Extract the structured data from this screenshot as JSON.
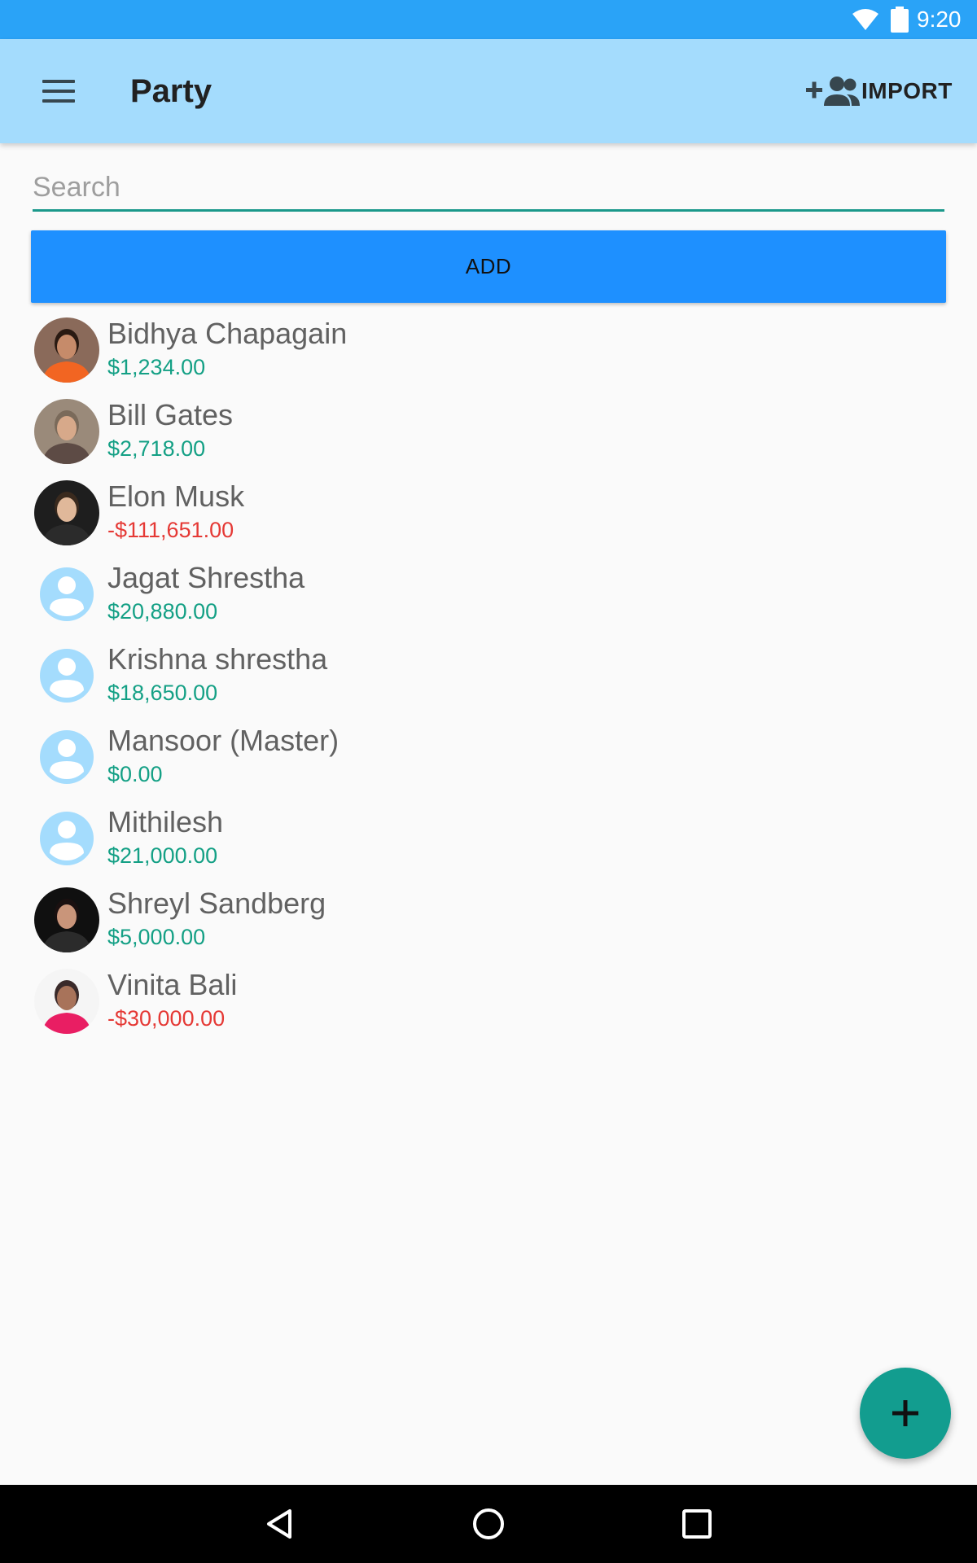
{
  "status_bar": {
    "time": "9:20",
    "icons": [
      "wifi-icon",
      "battery-icon"
    ]
  },
  "app_bar": {
    "title": "Party",
    "import_label": "IMPORT",
    "icons": [
      "menu-icon",
      "add-group-icon"
    ]
  },
  "search": {
    "placeholder": "Search",
    "value": ""
  },
  "add_button": {
    "label": "ADD"
  },
  "colors": {
    "status_bar": "#2aa3f7",
    "app_bar": "#a4dcfd",
    "accent": "#1b998b",
    "add_button": "#1e90ff",
    "fab": "#129d8f",
    "positive": "#14a085",
    "negative": "#e53935",
    "placeholder_avatar": "#a4dcfd"
  },
  "parties": [
    {
      "name": "Bidhya Chapagain",
      "balance": "$1,234.00",
      "status": "positive",
      "avatar": "photo"
    },
    {
      "name": "Bill Gates",
      "balance": "$2,718.00",
      "status": "positive",
      "avatar": "photo"
    },
    {
      "name": "Elon Musk",
      "balance": "-$111,651.00",
      "status": "negative",
      "avatar": "photo"
    },
    {
      "name": "Jagat Shrestha",
      "balance": "$20,880.00",
      "status": "positive",
      "avatar": "placeholder"
    },
    {
      "name": "Krishna shrestha",
      "balance": "$18,650.00",
      "status": "positive",
      "avatar": "placeholder"
    },
    {
      "name": "Mansoor (Master)",
      "balance": "$0.00",
      "status": "positive",
      "avatar": "placeholder"
    },
    {
      "name": "Mithilesh",
      "balance": "$21,000.00",
      "status": "positive",
      "avatar": "placeholder"
    },
    {
      "name": "Shreyl Sandberg",
      "balance": "$5,000.00",
      "status": "positive",
      "avatar": "photo"
    },
    {
      "name": "Vinita Bali",
      "balance": "-$30,000.00",
      "status": "negative",
      "avatar": "photo"
    }
  ],
  "fab": {
    "icon": "plus-icon"
  },
  "nav_bar": {
    "icons": [
      "back-icon",
      "home-icon",
      "recents-icon"
    ]
  }
}
